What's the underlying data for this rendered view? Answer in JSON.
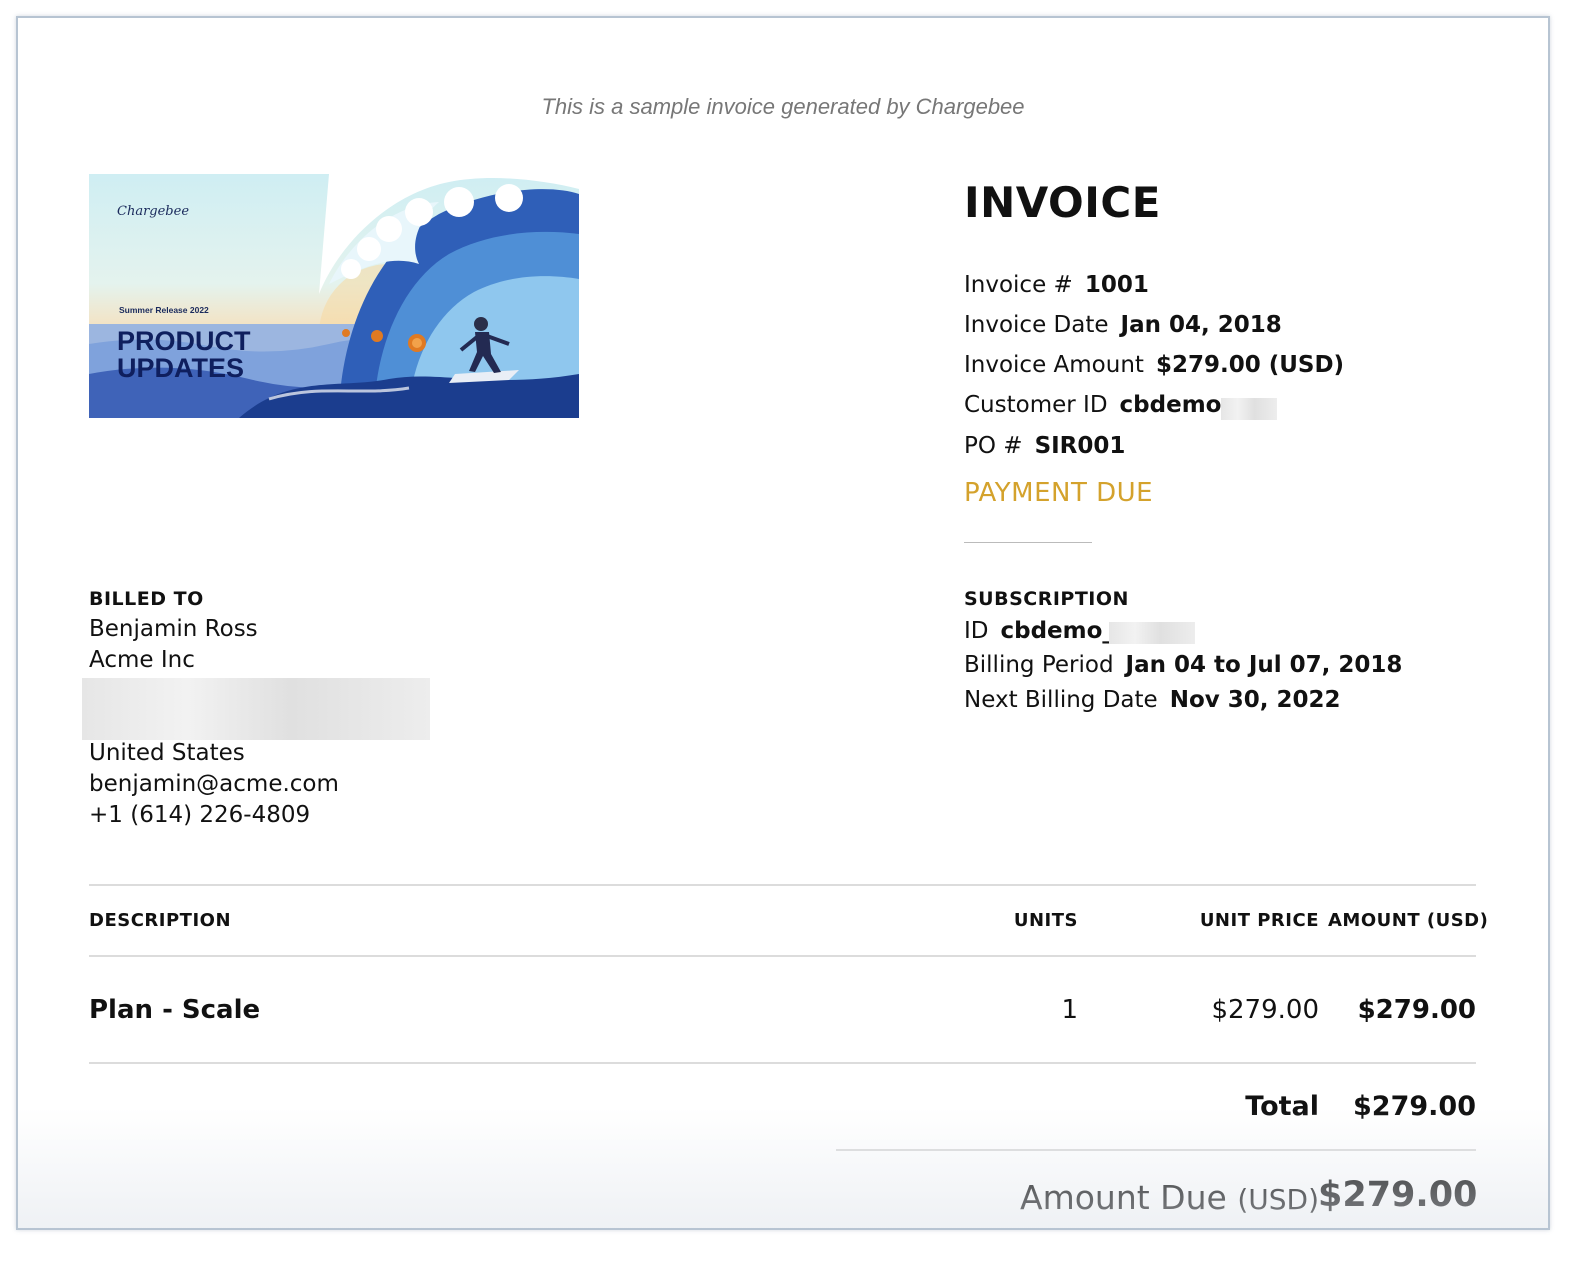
{
  "notice": "This is a sample invoice generated by Chargebee",
  "banner": {
    "logo_text": "Chargebee",
    "release_text": "Summer Release 2022",
    "title_line1": "PRODUCT",
    "title_line2": "UPDATES"
  },
  "invoice": {
    "title": "INVOICE",
    "fields": [
      {
        "label": "Invoice #",
        "value": "1001"
      },
      {
        "label": "Invoice Date",
        "value": "Jan 04, 2018"
      },
      {
        "label": "Invoice Amount",
        "value": "$279.00 (USD)"
      },
      {
        "label": "Customer ID",
        "value": "cbdemo_"
      },
      {
        "label": "PO #",
        "value": "SIR001"
      }
    ],
    "status": "PAYMENT DUE",
    "status_color": "#d4a22c"
  },
  "billed_to": {
    "label": "BILLED TO",
    "name": "Benjamin Ross",
    "company": "Acme Inc",
    "country": "United States",
    "email": "benjamin@acme.com",
    "phone": "+1 (614) 226-4809"
  },
  "subscription": {
    "label": "SUBSCRIPTION",
    "fields": [
      {
        "label": "ID",
        "value": "cbdemo_"
      },
      {
        "label": "Billing Period",
        "value": "Jan 04 to Jul 07, 2018"
      },
      {
        "label": "Next Billing Date",
        "value": "Nov 30, 2022"
      }
    ]
  },
  "table": {
    "headers": {
      "description": "DESCRIPTION",
      "units": "UNITS",
      "unit_price": "UNIT PRICE",
      "amount": "AMOUNT (USD)"
    },
    "rows": [
      {
        "description": "Plan - Scale",
        "units": "1",
        "unit_price": "$279.00",
        "amount": "$279.00"
      }
    ]
  },
  "totals": {
    "total_label": "Total",
    "total_value": "$279.00",
    "amount_due_label": "Amount Due",
    "amount_due_currency": "(USD)",
    "amount_due_value": "$279.00"
  }
}
